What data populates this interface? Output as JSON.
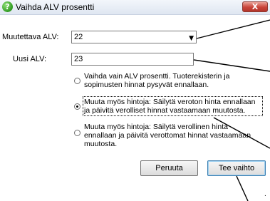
{
  "window": {
    "title": "Vaihda ALV prosentti",
    "close_label": "X",
    "icon": "green-question-icon"
  },
  "form": {
    "current_vat_label": "Muutettava ALV:",
    "current_vat_value": "22",
    "new_vat_label": "Uusi ALV:",
    "new_vat_value": "23"
  },
  "options": [
    {
      "line1": "Vaihda vain ALV prosentti. Tuoterekisterin ja",
      "line2": "sopimusten hinnat pysyvät ennallaan.",
      "line3": "",
      "checked": false
    },
    {
      "line1": "Muuta myös hintoja: Säilytä veroton hinta ennallaan",
      "line2": "ja päivitä verolliset hinnat vastaamaan muutosta.",
      "line3": "",
      "checked": true
    },
    {
      "line1": "Muuta myös hintoja: Säilytä verollinen hinta",
      "line2": "ennallaan ja päivitä verottomat hinnat vastaamaan",
      "line3": "muutosta.",
      "checked": false
    }
  ],
  "buttons": {
    "cancel": "Peruuta",
    "apply": "Tee vaihto"
  },
  "footer_mark": "."
}
